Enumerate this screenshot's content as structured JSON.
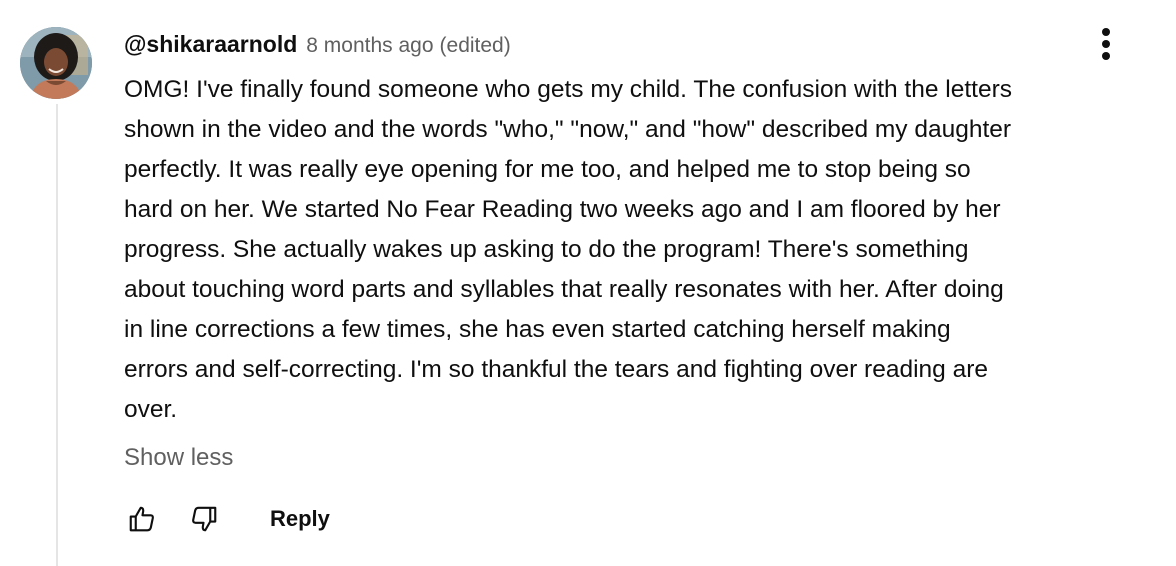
{
  "comment": {
    "author": "@shikaraarnold",
    "timestamp": "8 months ago",
    "edited": "(edited)",
    "avatar_icon": "user-avatar-photo",
    "lines": [
      "OMG! I've finally found someone who gets my child. The confusion with the letters",
      "shown in the video and the words \"who,\" \"now,\" and \"how\" described my daughter",
      "perfectly. It was really eye opening for me too, and helped me to stop being so",
      "hard on her. We started No Fear Reading two weeks ago and I am floored by her",
      "progress. She actually wakes up asking to do the program! There's something",
      "about touching word parts and syllables that really resonates with her. After doing",
      "in line corrections a few times, she has even started catching herself making",
      "errors and self-correcting. I'm so thankful the tears and fighting over reading are",
      "over."
    ],
    "show_less_label": "Show less",
    "reply_label": "Reply"
  },
  "icons": {
    "menu": "more-vertical-icon",
    "like": "thumbs-up-icon",
    "dislike": "thumbs-down-icon"
  },
  "colors": {
    "text_primary": "#0f0f0f",
    "text_secondary": "#606060",
    "thread_line": "#e5e5e5"
  }
}
